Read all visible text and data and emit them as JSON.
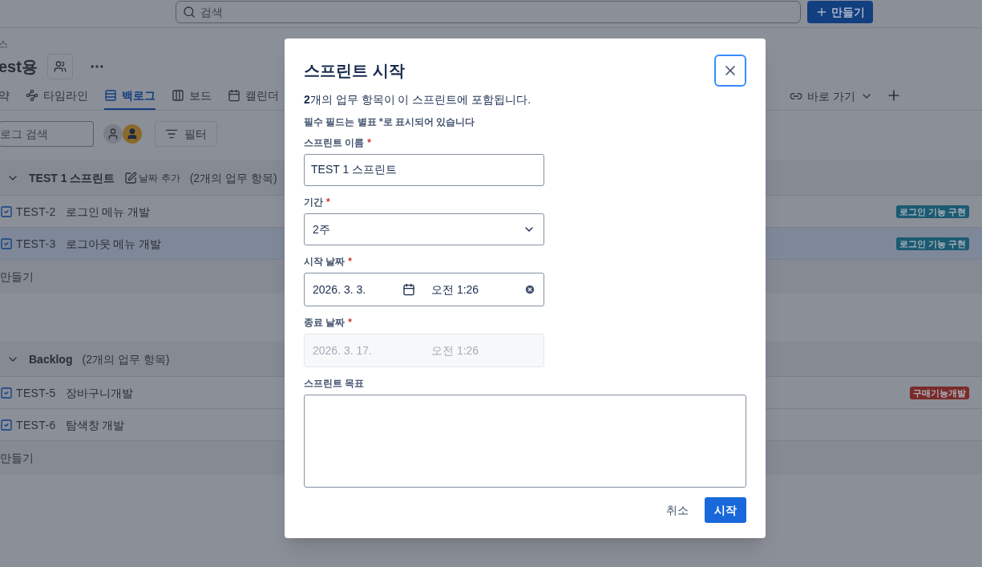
{
  "top_bar": {
    "search": {
      "placeholder": "검색"
    },
    "create_button": "만들기"
  },
  "project": {
    "breadcrumb": "스",
    "title": "est용"
  },
  "tabs": [
    {
      "label": "약",
      "selected": false
    },
    {
      "label": "타임라인",
      "selected": false
    },
    {
      "label": "백로그",
      "selected": true
    },
    {
      "label": "보드",
      "selected": false
    },
    {
      "label": "캘린더",
      "selected": false
    }
  ],
  "shortcut": {
    "label": "바로 가기"
  },
  "toolbar": {
    "search": {
      "placeholder": "로그 검색"
    },
    "filter_button": "필터"
  },
  "sections": [
    {
      "title": "TEST 1 스프린트",
      "add_date": "날짜 추가",
      "count": "(2개의 업무 항목)",
      "create": "만들기",
      "items": [
        {
          "key": "TEST-2",
          "summary": "로그인 메뉴 개발",
          "selected": false,
          "epic": {
            "label": "로그인 기능 구현",
            "color": "#1b5a72"
          }
        },
        {
          "key": "TEST-3",
          "summary": "로그아웃 메뉴 개발",
          "selected": true,
          "epic": {
            "label": "로그인 기능 구현",
            "color": "#1b5a72"
          }
        }
      ]
    },
    {
      "title": "Backlog",
      "count": "(2개의 업무 항목)",
      "create": "만들기",
      "items": [
        {
          "key": "TEST-5",
          "summary": "장바구니개발",
          "selected": false,
          "epic": {
            "label": "구매기능개발",
            "color": "#7a2a2a"
          }
        },
        {
          "key": "TEST-6",
          "summary": "탐색창 개발",
          "selected": false
        }
      ]
    }
  ],
  "dialog": {
    "title": "스프린트 시작",
    "intro": "**2**개의 업무 항목이 이 스프린트에 포함됩니다.",
    "required_note": "필수 필드는 별표 *로 표시되어 있습니다",
    "fields": [
      {
        "kind": "text",
        "label": "스프린트 이름",
        "required_mark": "*",
        "value": "TEST 1 스프린트"
      },
      {
        "kind": "select",
        "label": "기간",
        "required_mark": "*",
        "value": "2주"
      },
      {
        "kind": "datetime",
        "label": "시작 날짜",
        "required_mark": "*",
        "date": "2026. 3. 3.",
        "time": "오전 1:26",
        "disabled": false
      },
      {
        "kind": "datetime",
        "label": "종료 날짜",
        "required_mark": "*",
        "date": "2026. 3. 17.",
        "time": "오전 1:26",
        "disabled": true
      },
      {
        "kind": "textarea",
        "label": "스프린트 목표"
      }
    ],
    "cancel_button": "취소",
    "start_button": "시작"
  }
}
